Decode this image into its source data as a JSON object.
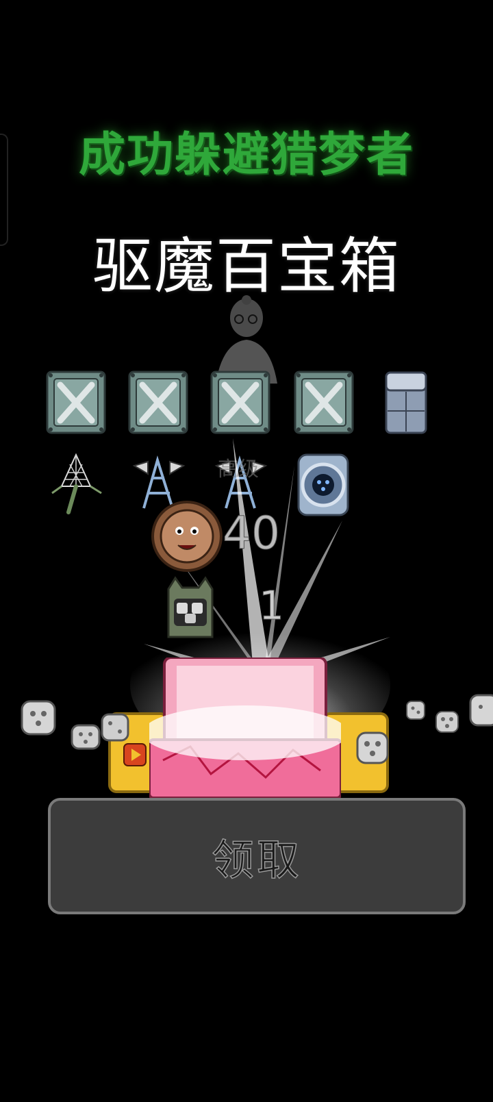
{
  "header": {
    "success_title": "成功躲避猎梦者",
    "reward_title": "驱魔百宝箱"
  },
  "rewards": {
    "faint_label": "高级",
    "amount_primary": "40",
    "amount_secondary": "1"
  },
  "actions": {
    "claim_label": "领取"
  },
  "colors": {
    "title_green": "#2fa83a",
    "button_bg": "#3c3c3c",
    "gold": "#f2c12e",
    "chest_pink": "#f4a7bf"
  },
  "icons": [
    "wrench-crate-icon",
    "cabinet-icon",
    "net-trap-icon",
    "radar-tower-icon",
    "speaker-icon",
    "monster-coin-icon",
    "dice-monster-icon",
    "treasure-chest-icon",
    "video-play-icon",
    "dice-icon"
  ]
}
